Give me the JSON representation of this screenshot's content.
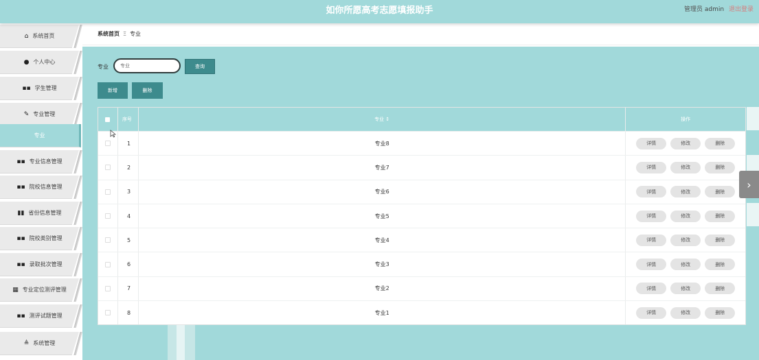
{
  "header": {
    "title": "如你所愿高考志愿填报助手",
    "role_label": "管理员",
    "username": "admin",
    "logout_label": "退出登录"
  },
  "sidebar": {
    "items": [
      {
        "label": "系统首页",
        "icon": "home-icon",
        "glyph": "⌂"
      },
      {
        "label": "个人中心",
        "icon": "user-icon",
        "glyph": "●"
      },
      {
        "label": "学生管理",
        "icon": "grid-icon",
        "glyph": "▪▪"
      },
      {
        "label": "专业管理",
        "icon": "thumb-icon",
        "glyph": "✎"
      },
      {
        "label": "专业",
        "icon": "",
        "glyph": ""
      },
      {
        "label": "专业信息管理",
        "icon": "grid-icon",
        "glyph": "▪▪"
      },
      {
        "label": "院校信息管理",
        "icon": "grid-icon",
        "glyph": "▪▪"
      },
      {
        "label": "省份信息管理",
        "icon": "chart-icon",
        "glyph": "▮▮"
      },
      {
        "label": "院校类别管理",
        "icon": "grid-icon",
        "glyph": "▪▪"
      },
      {
        "label": "录取批次管理",
        "icon": "grid-icon",
        "glyph": "▪▪"
      },
      {
        "label": "专业定位测评管理",
        "icon": "apps-icon",
        "glyph": "▦"
      },
      {
        "label": "测评试题管理",
        "icon": "grid-icon",
        "glyph": "▪▪"
      },
      {
        "label": "系统管理",
        "icon": "settings-icon",
        "glyph": "≜"
      }
    ]
  },
  "breadcrumb": {
    "home": "系统首页",
    "separator": "Ξ",
    "current": "专业"
  },
  "search": {
    "label": "专业",
    "placeholder": "专业",
    "query_button": "查询"
  },
  "actions": {
    "add_button": "新增",
    "delete_button": "删除"
  },
  "table": {
    "columns": {
      "index": "序号",
      "name": "专业 ↕",
      "operation": "操作"
    },
    "rows": [
      {
        "index": "1",
        "name": "专业8"
      },
      {
        "index": "2",
        "name": "专业7"
      },
      {
        "index": "3",
        "name": "专业6"
      },
      {
        "index": "4",
        "name": "专业5"
      },
      {
        "index": "5",
        "name": "专业4"
      },
      {
        "index": "6",
        "name": "专业3"
      },
      {
        "index": "7",
        "name": "专业2"
      },
      {
        "index": "8",
        "name": "专业1"
      }
    ],
    "row_actions": {
      "detail": "详情",
      "edit": "修改",
      "delete": "删除"
    }
  },
  "colors": {
    "accent": "#a1d9da",
    "button": "#3d8b8d",
    "logout": "#d67e7e"
  }
}
